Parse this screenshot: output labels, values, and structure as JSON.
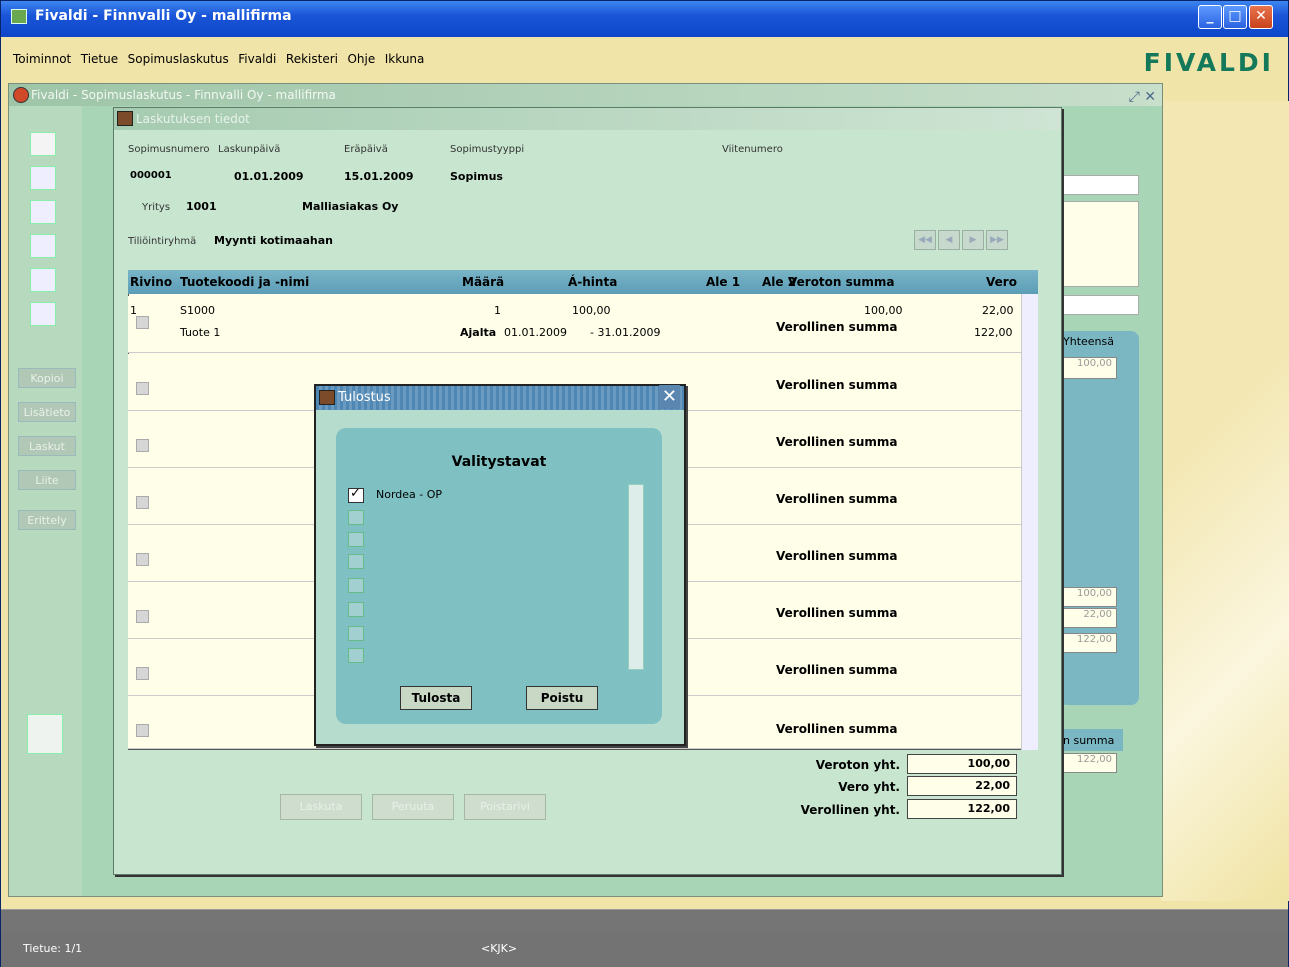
{
  "app": {
    "title": "Fivaldi - Finnvalli Oy - mallifirma",
    "logo": "FIVALDI"
  },
  "menu": [
    "Toiminnot",
    "Tietue",
    "Sopimuslaskutus",
    "Fivaldi",
    "Rekisteri",
    "Ohje",
    "Ikkuna"
  ],
  "inner_window": {
    "title": "Fivaldi - Sopimuslaskutus - Finnvalli Oy - mallifirma"
  },
  "side_buttons": [
    "Kopioi",
    "Lisätieto",
    "Laskut",
    "Liite",
    "Erittely"
  ],
  "form": {
    "title": "Laskutuksen tiedot",
    "labels": {
      "contract_no": "Sopimusnumero",
      "invoice_date": "Laskunpäivä",
      "due_date": "Eräpäivä",
      "contract_type": "Sopimustyyppi",
      "reference": "Viitenumero",
      "company": "Yritys",
      "account_group": "Tiliöintiryhmä"
    },
    "values": {
      "contract_no": "000001",
      "invoice_date": "01.01.2009",
      "due_date": "15.01.2009",
      "contract_type": "Sopimus",
      "company_no": "1001",
      "company_name": "Malliasiakas Oy",
      "account_group": "Myynti kotimaahan"
    }
  },
  "grid": {
    "headers": [
      "Rivino",
      "Tuotekoodi ja -nimi",
      "Määrä",
      "Á-hinta",
      "Ale 1",
      "Ale 2",
      "Veroton summa",
      "Vero"
    ],
    "row1": {
      "rivino": "1",
      "code": "S1000",
      "name": "Tuote 1",
      "maara": "1",
      "hinta": "100,00",
      "veroton": "100,00",
      "vero": "22,00",
      "verollinen": "122,00",
      "ajalta_label": "Ajalta",
      "from": "01.01.2009",
      "to": "- 31.01.2009"
    },
    "row_label": "Verollinen summa"
  },
  "totals": {
    "veroton_label": "Veroton yht.",
    "veroton": "100,00",
    "vero_label": "Vero yht.",
    "vero": "22,00",
    "verollinen_label": "Verollinen yht.",
    "verollinen": "122,00"
  },
  "bottom_buttons": [
    "Laskuta",
    "Peruuta",
    "Poistarivi"
  ],
  "right_panel": {
    "header1": "Yhteensä",
    "val1": "100,00",
    "t1": "100,00",
    "t2": "22,00",
    "t3": "122,00",
    "header2": "n summa",
    "val2": "122,00"
  },
  "dialog": {
    "title": "Tulostus",
    "heading": "Valitystavat",
    "option1": "Nordea - OP",
    "print_label": "Tulosta",
    "exit_label": "Poistu"
  },
  "status": {
    "record": "Tietue: 1/1",
    "mode": "<KJK>"
  }
}
